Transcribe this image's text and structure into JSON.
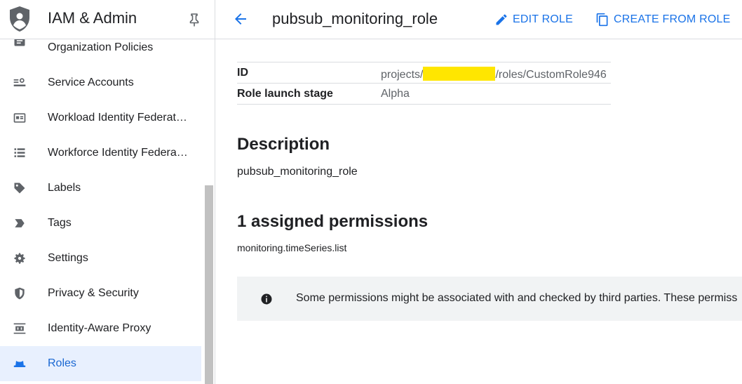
{
  "sidebar": {
    "title": "IAM & Admin",
    "items": [
      {
        "label": "Organization Policies",
        "icon": "policy-icon"
      },
      {
        "label": "Service Accounts",
        "icon": "service-account-icon"
      },
      {
        "label": "Workload Identity Federat…",
        "icon": "workload-identity-icon"
      },
      {
        "label": "Workforce Identity Federa…",
        "icon": "workforce-identity-icon"
      },
      {
        "label": "Labels",
        "icon": "label-icon"
      },
      {
        "label": "Tags",
        "icon": "tag-icon"
      },
      {
        "label": "Settings",
        "icon": "gear-icon"
      },
      {
        "label": "Privacy & Security",
        "icon": "shield-icon"
      },
      {
        "label": "Identity-Aware Proxy",
        "icon": "proxy-icon"
      },
      {
        "label": "Roles",
        "icon": "roles-icon",
        "active": true
      }
    ]
  },
  "header": {
    "title": "pubsub_monitoring_role",
    "edit_label": "EDIT ROLE",
    "create_label": "CREATE FROM ROLE"
  },
  "details": {
    "id_label": "ID",
    "id_prefix": "projects/",
    "id_suffix": "/roles/CustomRole946",
    "stage_label": "Role launch stage",
    "stage_value": "Alpha"
  },
  "description": {
    "title": "Description",
    "text": "pubsub_monitoring_role"
  },
  "permissions": {
    "title": "1 assigned permissions",
    "items": [
      "monitoring.timeSeries.list"
    ]
  },
  "notice": {
    "text": "Some permissions might be associated with and checked by third parties. These permiss"
  },
  "colors": {
    "accent": "#1a73e8",
    "active_bg": "#e8f0fe",
    "redaction": "#ffe600",
    "notice_bg": "#f1f3f4"
  }
}
